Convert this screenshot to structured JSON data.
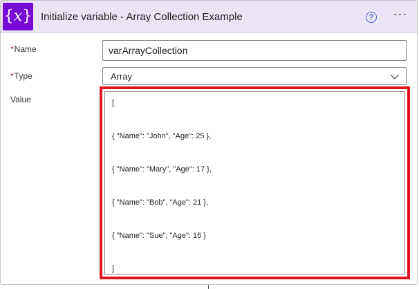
{
  "header": {
    "icon_glyph": "x",
    "icon_brace_open": "{",
    "icon_brace_close": "}",
    "title": "Initialize variable - Array Collection Example",
    "help_icon": "question-circle-icon",
    "help_glyph": "?",
    "more_icon": "ellipsis-icon",
    "more_glyph": "···",
    "accent": "#770bd6",
    "background": "#ebe3f6"
  },
  "fields": {
    "required_mark": "*",
    "name": {
      "label": "Name",
      "value": "varArrayCollection"
    },
    "type": {
      "label": "Type",
      "selected": "Array",
      "dropdown_icon": "chevron-down-icon"
    },
    "value": {
      "label": "Value",
      "lines": [
        "[",
        "{ \"Name\": \"John\", \"Age\": 25 },",
        "{ \"Name\": \"Mary\", \"Age\": 17 },",
        "{ \"Name\": \"Bob\", \"Age\": 21 },",
        "{ \"Name\": \"Sue\", \"Age\": 16 }",
        "]"
      ],
      "highlight_color": "#e0141e"
    }
  }
}
